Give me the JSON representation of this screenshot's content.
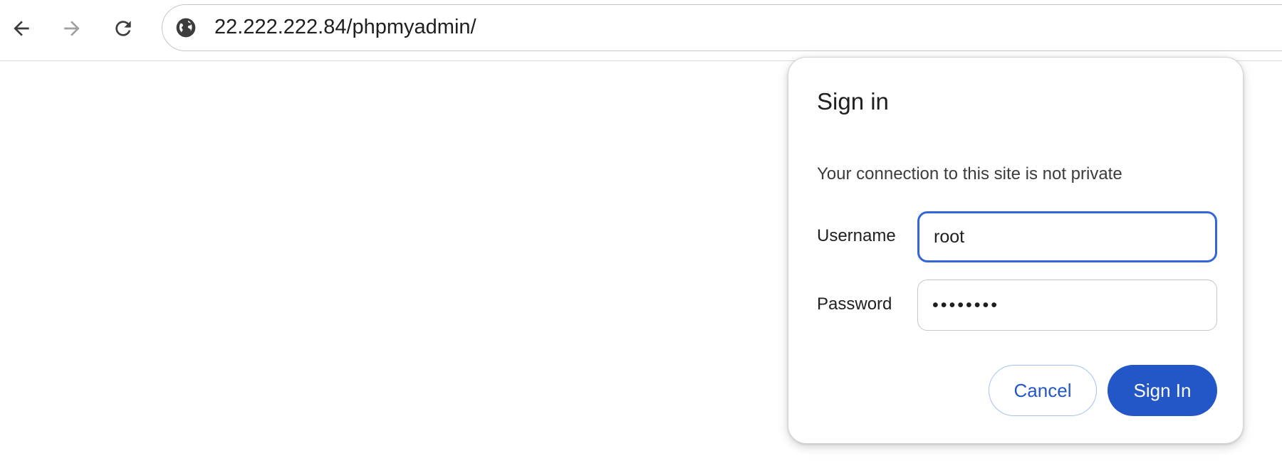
{
  "browser": {
    "url": "22.222.222.84/phpmyadmin/",
    "icons": {
      "back": "arrow-left-icon",
      "forward": "arrow-right-icon",
      "reload": "reload-icon",
      "site": "globe-icon"
    }
  },
  "auth_dialog": {
    "title": "Sign in",
    "subtitle": "Your connection to this site is not private",
    "username_label": "Username",
    "username_value": "root",
    "password_label": "Password",
    "password_value": "••••••••",
    "cancel_label": "Cancel",
    "signin_label": "Sign In"
  },
  "colors": {
    "accent": "#2356c6",
    "focus_border": "#3367d6"
  }
}
